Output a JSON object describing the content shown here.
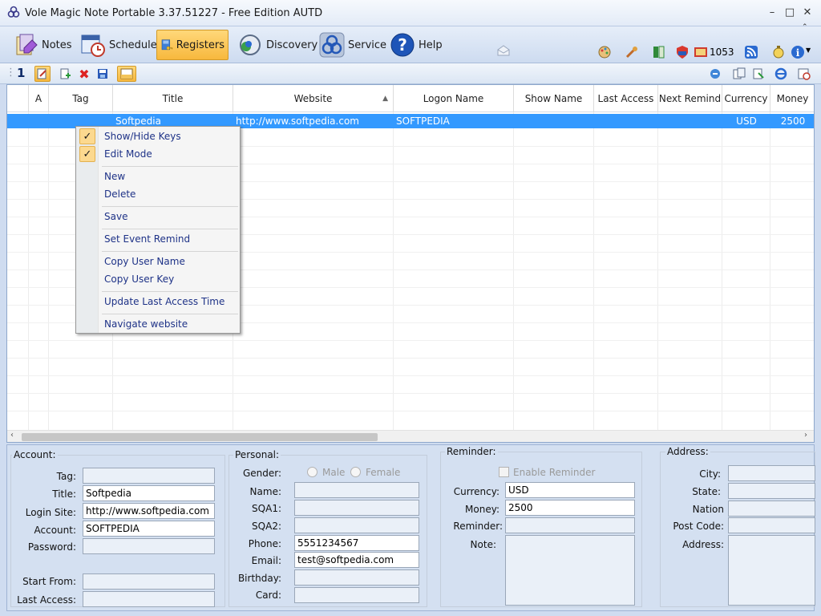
{
  "window": {
    "title": "Vole Magic Note Portable  3.37.51227 - Free Edition AUTD"
  },
  "toolbar": {
    "notes": "Notes",
    "schedule": "Schedule",
    "registers": "Registers",
    "discovery": "Discovery",
    "service": "Service",
    "help": "Help",
    "count": "1053"
  },
  "toolbar2": {
    "page_number": "1"
  },
  "grid": {
    "columns": [
      "A",
      "Tag",
      "Title",
      "Website",
      "Logon Name",
      "Show Name",
      "Last Access",
      "Next Remind",
      "Currency",
      "Money"
    ],
    "selected_row": {
      "title": "Softpedia",
      "website": "http://www.softpedia.com",
      "logon_name": "SOFTPEDIA",
      "currency": "USD",
      "money": "2500"
    }
  },
  "context_menu": {
    "items": [
      "Show/Hide Keys",
      "Edit Mode",
      "New",
      "Delete",
      "Save",
      "Set Event Remind",
      "Copy User Name",
      "Copy User Key",
      "Update Last Access Time",
      "Navigate website"
    ]
  },
  "account": {
    "title": "Account:",
    "labels": {
      "tag": "Tag:",
      "title": "Title:",
      "login_site": "Login Site:",
      "account": "Account:",
      "password": "Password:",
      "start_from": "Start From:",
      "last_access": "Last Access:"
    },
    "values": {
      "tag": "",
      "title": "Softpedia",
      "login_site": "http://www.softpedia.com",
      "account": "SOFTPEDIA",
      "password": "",
      "start_from": "",
      "last_access": ""
    }
  },
  "personal": {
    "title": "Personal:",
    "labels": {
      "gender": "Gender:",
      "male": "Male",
      "female": "Female",
      "name": "Name:",
      "sqa1": "SQA1:",
      "sqa2": "SQA2:",
      "phone": "Phone:",
      "email": "Email:",
      "birthday": "Birthday:",
      "card": "Card:"
    },
    "values": {
      "name": "",
      "sqa1": "",
      "sqa2": "",
      "phone": "5551234567",
      "email": "test@softpedia.com",
      "birthday": "",
      "card": ""
    }
  },
  "reminder": {
    "title": "Reminder:",
    "enable_label": "Enable Reminder",
    "labels": {
      "currency": "Currency:",
      "money": "Money:",
      "reminder": "Reminder:",
      "note": "Note:"
    },
    "values": {
      "currency": "USD",
      "money": "2500",
      "reminder": "",
      "note": ""
    }
  },
  "address": {
    "title": "Address:",
    "labels": {
      "city": "City:",
      "state": "State:",
      "nation": "Nation",
      "post_code": "Post Code:",
      "address": "Address:"
    }
  },
  "colors": {
    "selection": "#3399ff",
    "menu_text": "#1e3287",
    "active_button": "#f7b83d"
  }
}
